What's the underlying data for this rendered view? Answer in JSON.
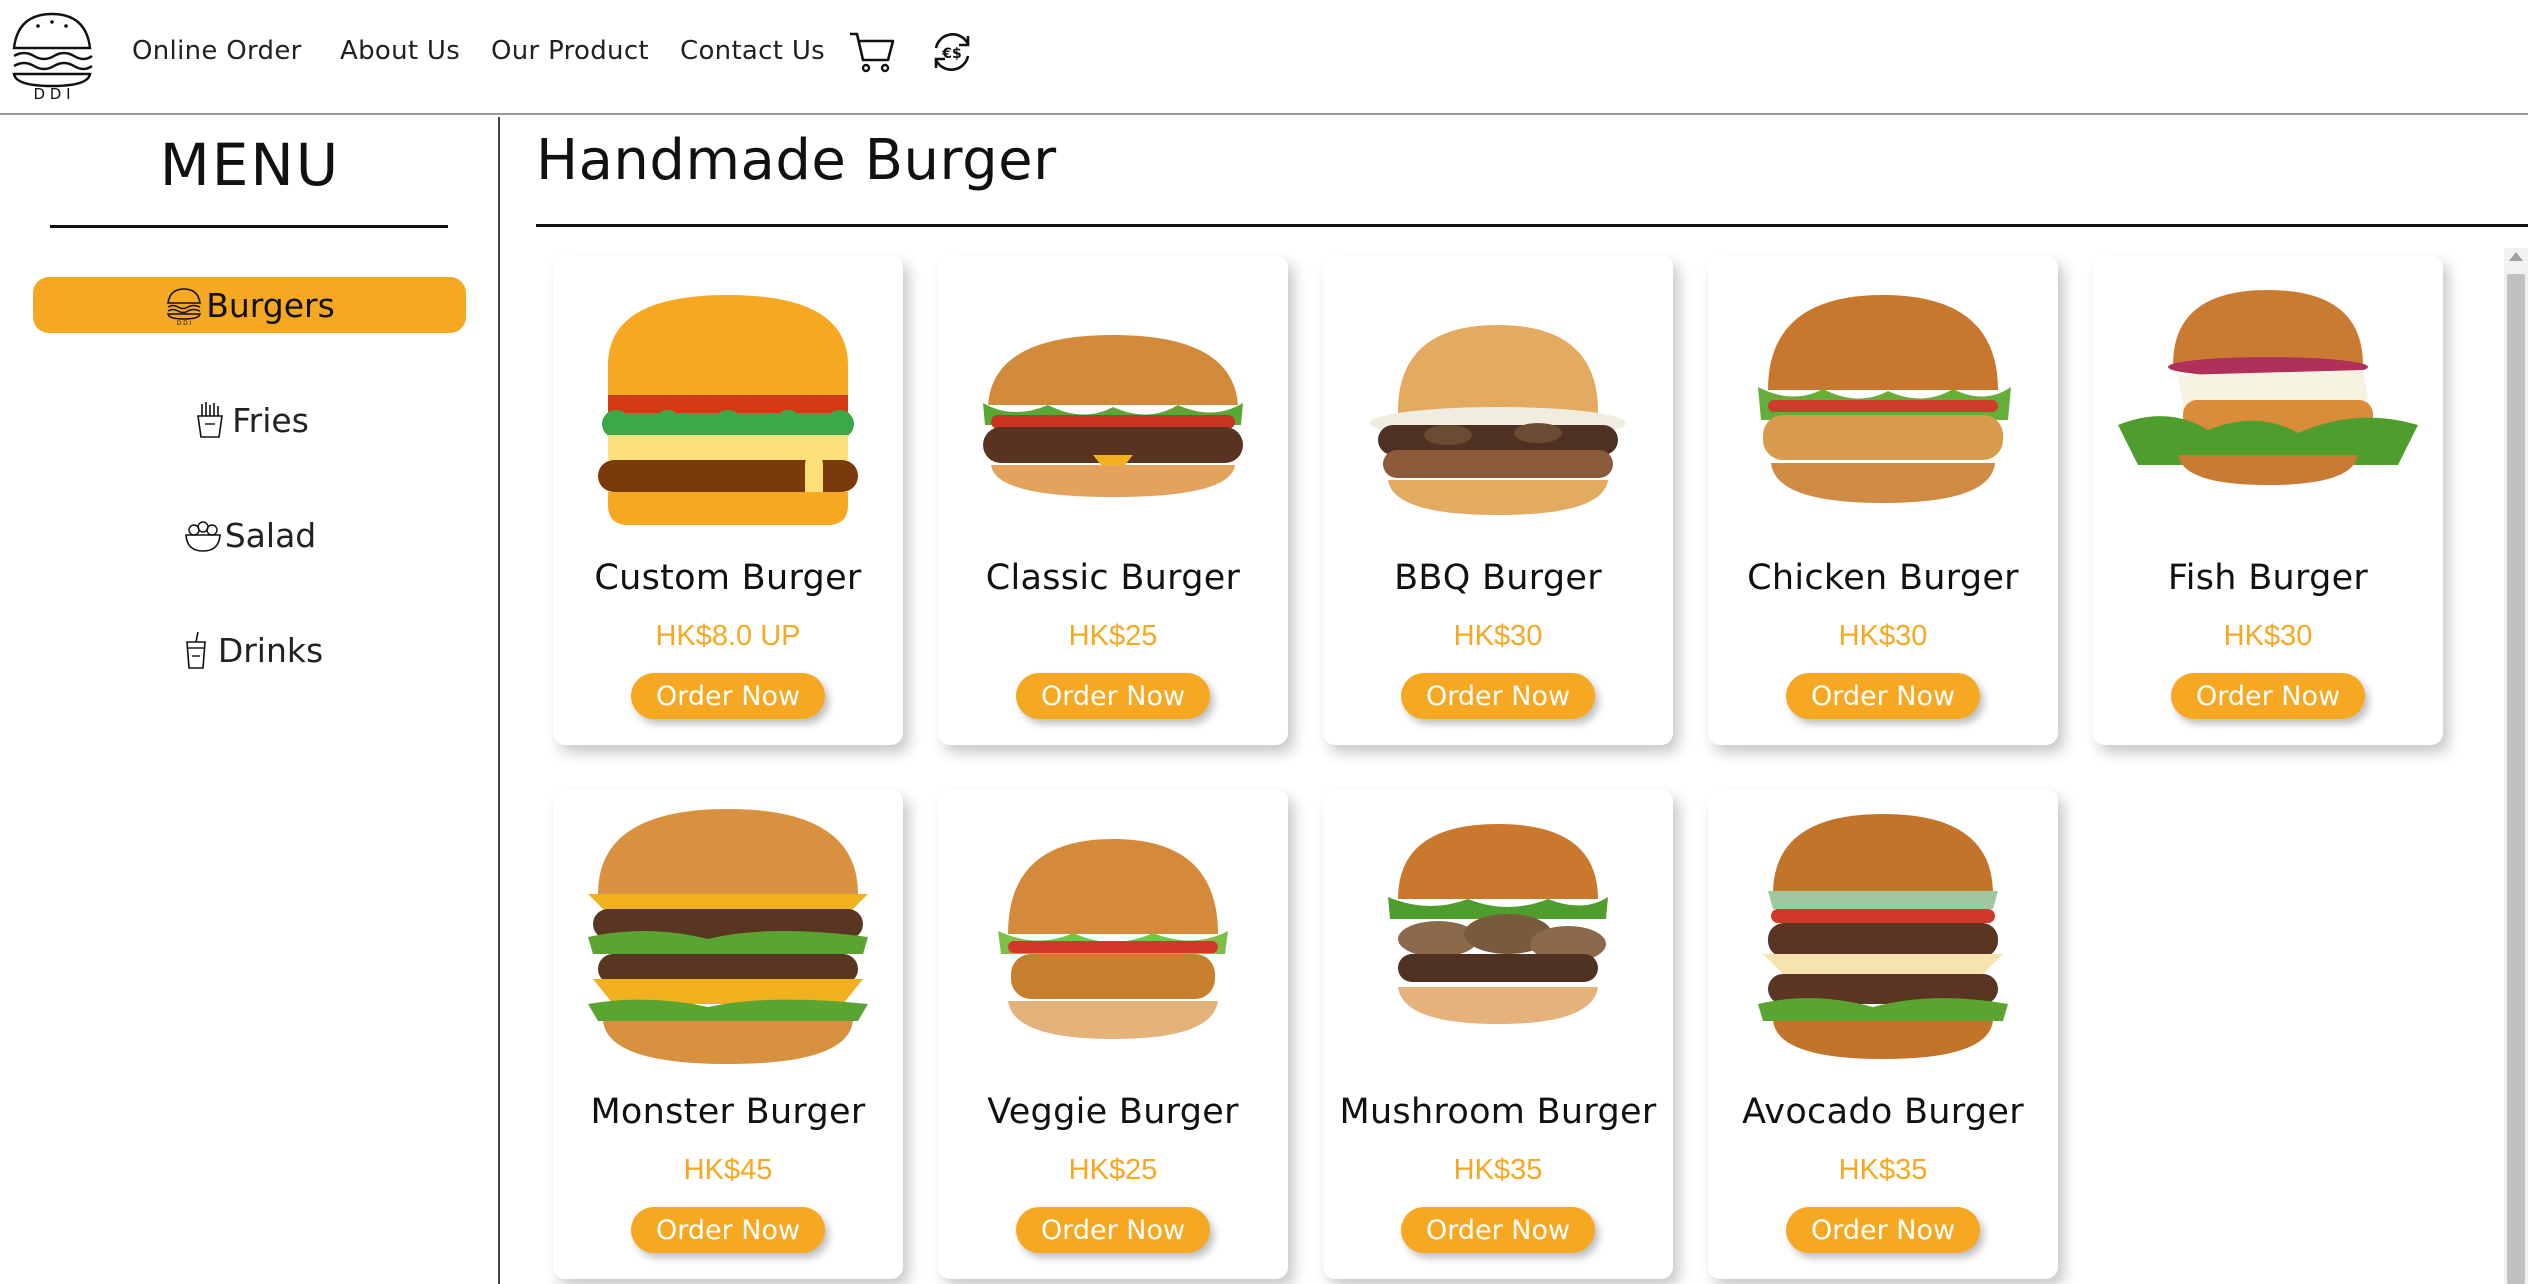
{
  "brand": {
    "logo_text": "D D I"
  },
  "nav": {
    "items": [
      {
        "label": "Online Order"
      },
      {
        "label": "About Us"
      },
      {
        "label": "Our Product"
      },
      {
        "label": "Contact Us"
      }
    ],
    "cart_icon": "cart-icon",
    "currency_icon": "currency-exchange-icon"
  },
  "sidebar": {
    "title": "MENU",
    "categories": [
      {
        "label": "Burgers",
        "icon": "burger-icon",
        "active": true
      },
      {
        "label": "Fries",
        "icon": "fries-icon",
        "active": false
      },
      {
        "label": "Salad",
        "icon": "salad-icon",
        "active": false
      },
      {
        "label": "Drinks",
        "icon": "drink-icon",
        "active": false
      }
    ]
  },
  "main": {
    "title": "Handmade Burger",
    "order_label": "Order Now",
    "products": [
      {
        "name": "Custom Burger",
        "price": "HK$8.0 UP"
      },
      {
        "name": "Classic Burger",
        "price": "HK$25"
      },
      {
        "name": "BBQ Burger",
        "price": "HK$30"
      },
      {
        "name": "Chicken Burger",
        "price": "HK$30"
      },
      {
        "name": "Fish Burger",
        "price": "HK$30"
      },
      {
        "name": "Monster Burger",
        "price": "HK$45"
      },
      {
        "name": "Veggie Burger",
        "price": "HK$25"
      },
      {
        "name": "Mushroom Burger",
        "price": "HK$35"
      },
      {
        "name": "Avocado Burger",
        "price": "HK$35"
      }
    ]
  },
  "colors": {
    "accent": "#f6a823",
    "text": "#111111"
  }
}
